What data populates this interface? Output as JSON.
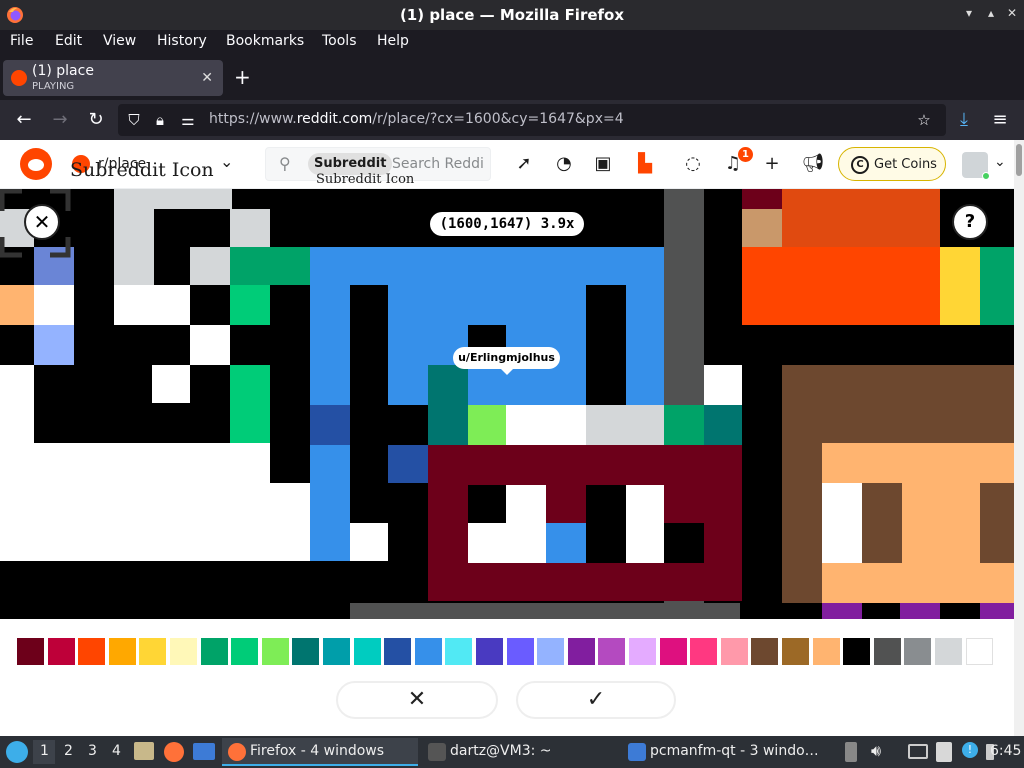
{
  "window": {
    "title": "(1) place — Mozilla Firefox"
  },
  "menu": [
    "File",
    "Edit",
    "View",
    "History",
    "Bookmarks",
    "Tools",
    "Help"
  ],
  "tab": {
    "title": "(1) place",
    "subtitle": "PLAYING"
  },
  "url": {
    "prefix": "https://www.",
    "domain": "reddit.com",
    "path": "/r/place/?cx=1600&cy=1647&px=4"
  },
  "reddit": {
    "subreddit": "r/place",
    "subreddit_icon_alt": "Subreddit Icon",
    "search_chip": "Subreddit",
    "search_chip_alt": "Subreddit Icon",
    "search_placeholder": "Search Reddit",
    "notification_count": "1",
    "get_coins": "Get Coins"
  },
  "canvas": {
    "coords": "(1600,1647) 3.9x",
    "username": "u/Erlingmjolhus",
    "help_label": "?"
  },
  "palette": {
    "colors": [
      "#6d001a",
      "#be0039",
      "#ff4500",
      "#ffa800",
      "#ffd635",
      "#fff8b8",
      "#00a368",
      "#00cc78",
      "#7eed56",
      "#00756f",
      "#009eaa",
      "#00ccc0",
      "#2450a4",
      "#3690ea",
      "#51e9f4",
      "#493ac1",
      "#6a5cff",
      "#94b3ff",
      "#811e9f",
      "#b44ac0",
      "#e4abff",
      "#de107f",
      "#ff3881",
      "#ff99aa",
      "#6d482f",
      "#9c6926",
      "#ffb470",
      "#000000",
      "#515252",
      "#898d90",
      "#d4d7d9",
      "#ffffff"
    ]
  },
  "taskbar": {
    "workspaces": [
      "1",
      "2",
      "3",
      "4"
    ],
    "tasks": [
      {
        "label": "Firefox - 4 windows",
        "active": true
      },
      {
        "label": "dartz@VM3: ~",
        "active": false
      },
      {
        "label": "pcmanfm-qt - 3 windo…",
        "active": false
      }
    ],
    "clock": "6:45"
  },
  "colors": {
    "accent": "#ff4500",
    "firefox_dark": "#1c1b22",
    "taskbar": "#2c3036"
  }
}
